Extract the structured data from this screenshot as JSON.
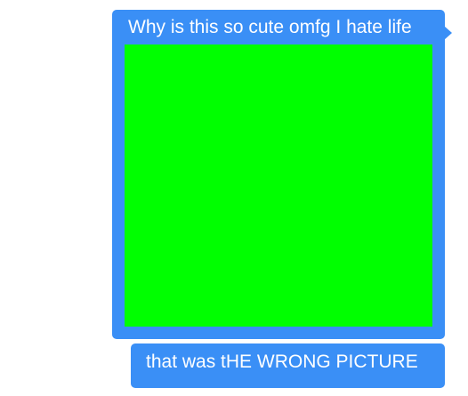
{
  "messages": [
    {
      "text": "Why is this so cute omfg I hate life",
      "attachment": {
        "type": "image",
        "fill_color": "#00ff00"
      }
    },
    {
      "text": "that was tHE WRONG PICTURE"
    }
  ],
  "colors": {
    "bubble": "#3a8ff6",
    "bubble_text": "#ffffff",
    "background": "#ffffff"
  }
}
